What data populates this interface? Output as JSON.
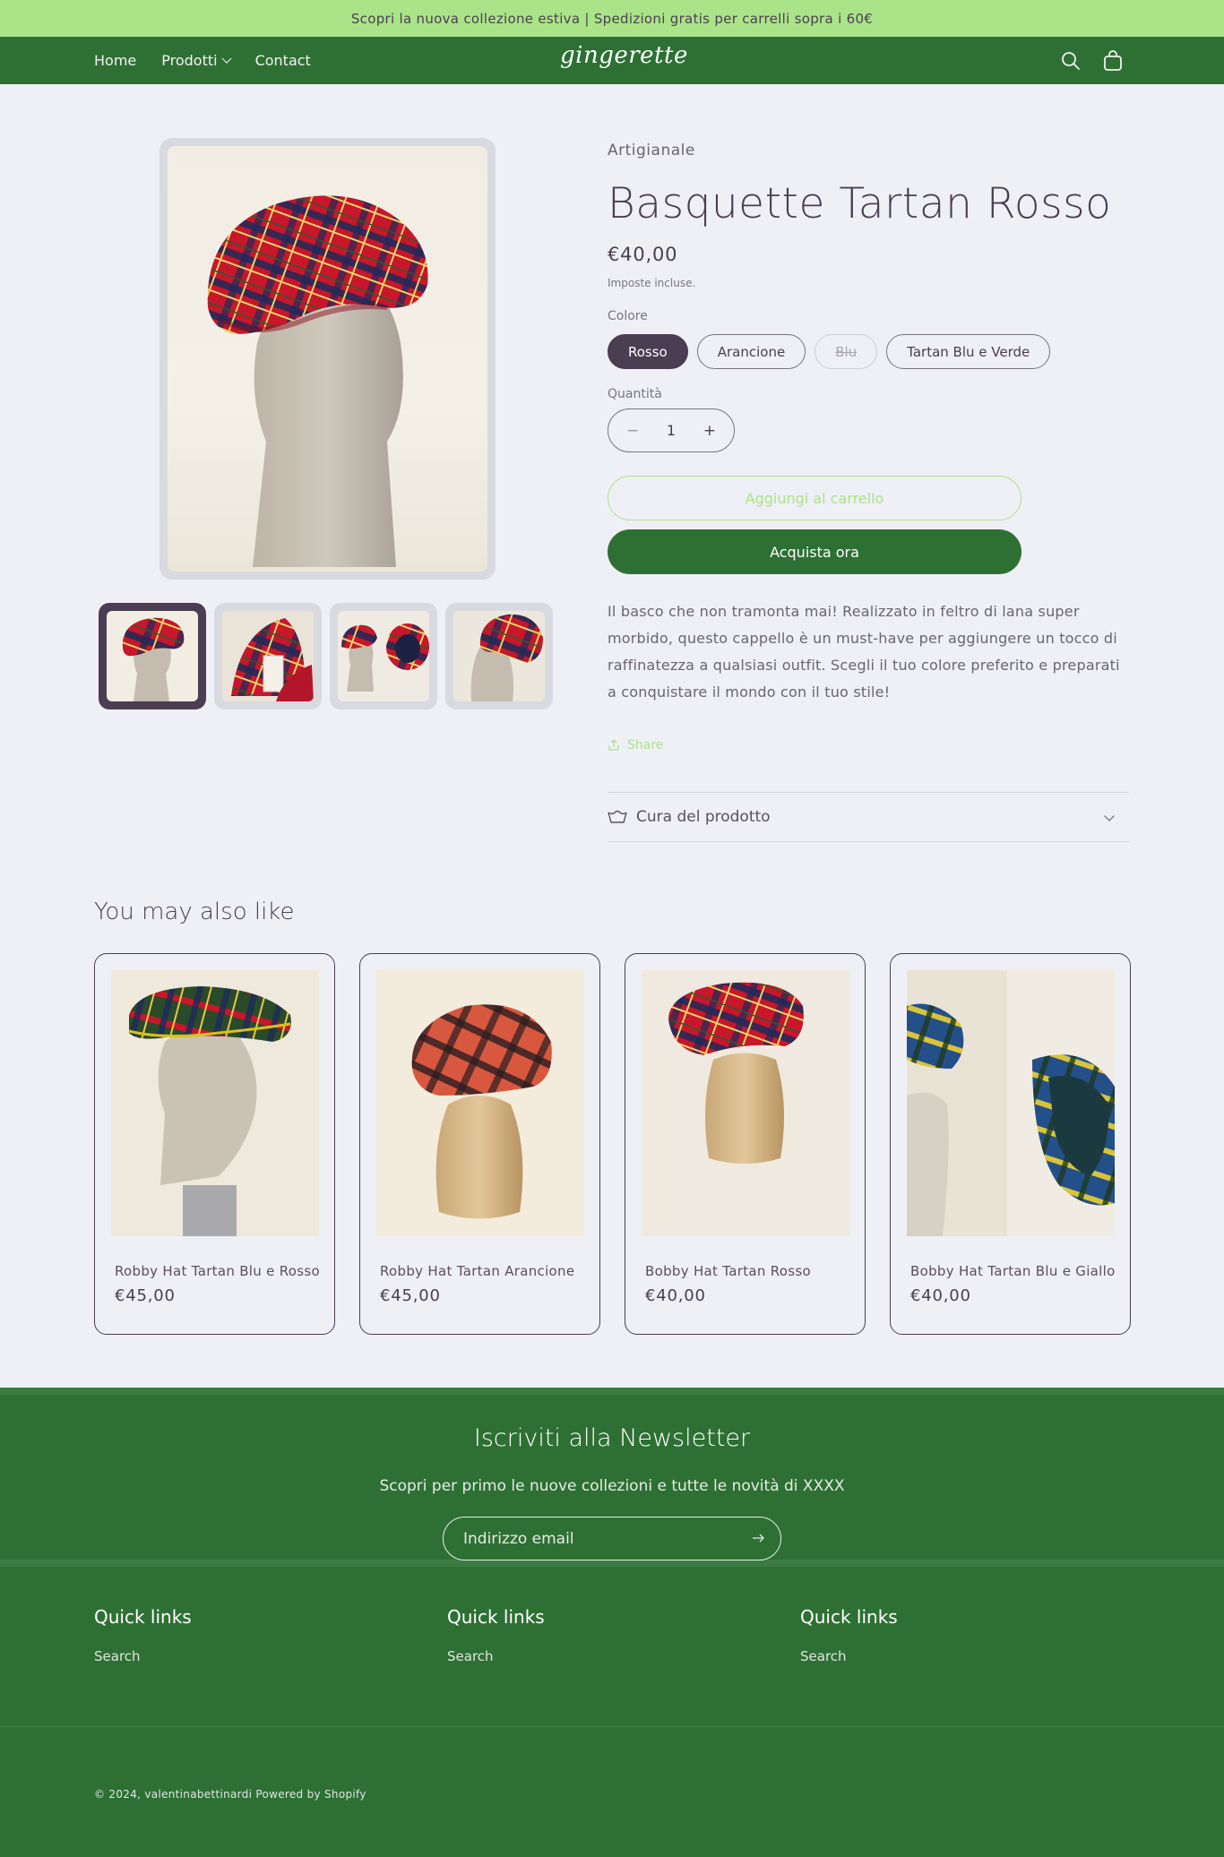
{
  "announcement": "Scopri la nuova collezione estiva | Spedizioni gratis per carrelli sopra i 60€",
  "header": {
    "nav": [
      "Home",
      "Prodotti",
      "Contact"
    ],
    "logo": "gingerette",
    "search_icon": "search-icon",
    "cart_icon": "bag-icon"
  },
  "product": {
    "vendor": "Artigianale",
    "title": "Basquette Tartan Rosso",
    "price": "€40,00",
    "tax_note": "Imposte incluse.",
    "color_label": "Colore",
    "colors": [
      "Rosso",
      "Arancione",
      "Blu",
      "Tartan Blu e Verde"
    ],
    "selected_color": "Rosso",
    "unavailable_color": "Blu",
    "quantity_label": "Quantità",
    "quantity": "1",
    "minus": "−",
    "plus": "+",
    "add_to_cart": "Aggiungi al carrello",
    "buy_now": "Acquista ora",
    "description": "Il basco che non tramonta mai! Realizzato in feltro di lana super morbido, questo cappello è un must-have per aggiungere un tocco di raffinatezza a qualsiasi outfit. Scegli il tuo colore preferito e preparati a conquistare il mondo con il tuo stile!",
    "share": "Share",
    "care": "Cura del prodotto"
  },
  "related": {
    "title": "You may also like",
    "items": [
      {
        "name": "Robby Hat Tartan Blu e Rosso",
        "price": "€45,00"
      },
      {
        "name": "Robby Hat Tartan Arancione",
        "price": "€45,00"
      },
      {
        "name": "Bobby Hat Tartan Rosso",
        "price": "€40,00"
      },
      {
        "name": "Bobby Hat Tartan Blu e Giallo",
        "price": "€40,00"
      }
    ]
  },
  "newsletter": {
    "title": "Iscriviti alla Newsletter",
    "subtitle": "Scopri per primo le nuove collezioni e tutte le novità di XXXX",
    "placeholder": "Indirizzo email"
  },
  "footer": {
    "columns": [
      {
        "heading": "Quick links",
        "link": "Search"
      },
      {
        "heading": "Quick links",
        "link": "Search"
      },
      {
        "heading": "Quick links",
        "link": "Search"
      }
    ],
    "copyright": "© 2024, valentinabettinardi Powered by Shopify"
  },
  "colors": {
    "announce_bg": "#abe389",
    "header_bg": "#2e7034",
    "accent_dark": "#4b3d52",
    "page_bg": "#eff0f5"
  }
}
